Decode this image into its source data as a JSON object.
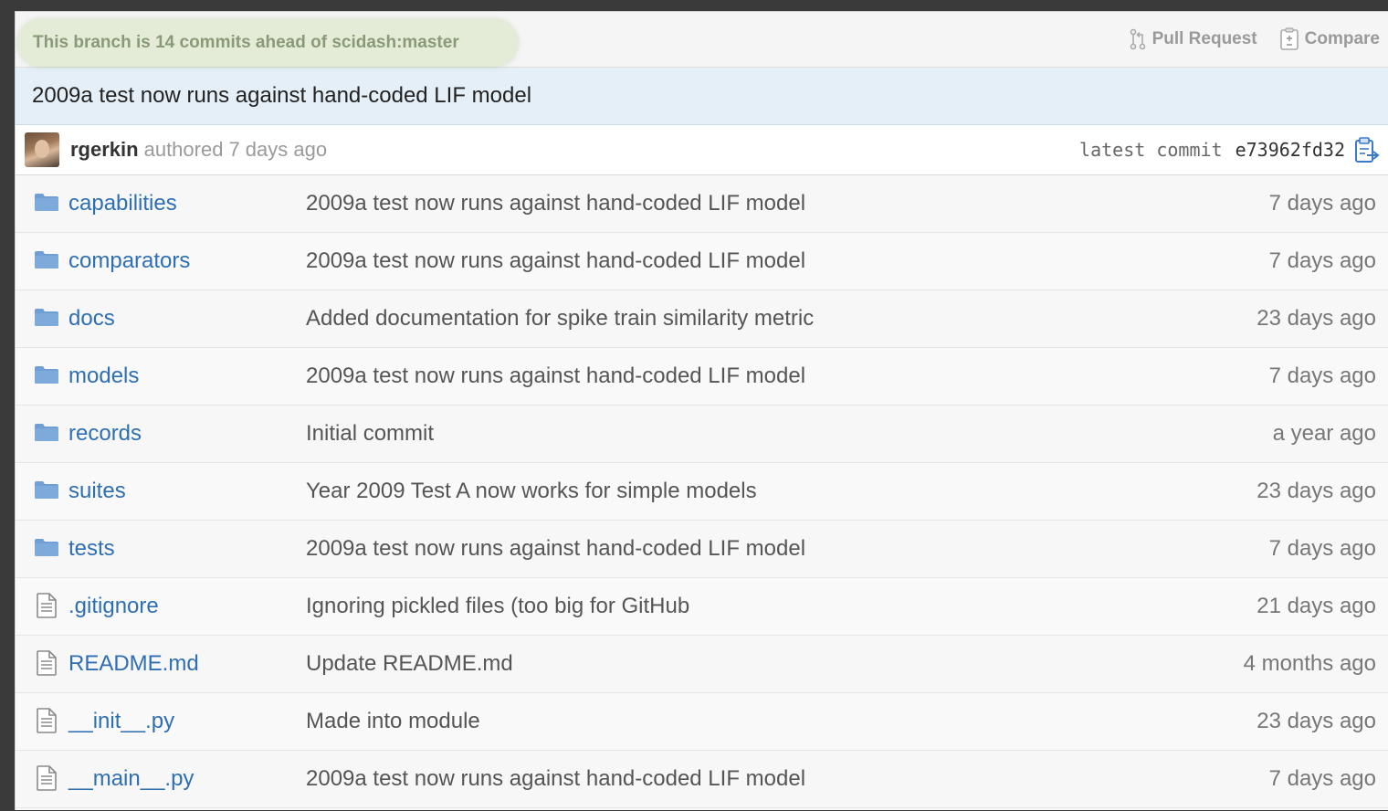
{
  "branch": {
    "status": "This branch is 14 commits ahead of scidash:master",
    "pull_request_label": "Pull Request",
    "compare_label": "Compare"
  },
  "commit": {
    "message": "2009a test now runs against hand-coded LIF model",
    "author": "rgerkin",
    "authored_label": "authored",
    "time": "7 days ago",
    "latest_label": "latest commit",
    "sha": "e73962fd32"
  },
  "files": [
    {
      "type": "folder",
      "name": "capabilities",
      "message": "2009a test now runs against hand-coded LIF model",
      "age": "7 days ago"
    },
    {
      "type": "folder",
      "name": "comparators",
      "message": "2009a test now runs against hand-coded LIF model",
      "age": "7 days ago"
    },
    {
      "type": "folder",
      "name": "docs",
      "message": "Added documentation for spike train similarity metric",
      "age": "23 days ago"
    },
    {
      "type": "folder",
      "name": "models",
      "message": "2009a test now runs against hand-coded LIF model",
      "age": "7 days ago"
    },
    {
      "type": "folder",
      "name": "records",
      "message": "Initial commit",
      "age": "a year ago"
    },
    {
      "type": "folder",
      "name": "suites",
      "message": "Year 2009 Test A now works for simple models",
      "age": "23 days ago"
    },
    {
      "type": "folder",
      "name": "tests",
      "message": "2009a test now runs against hand-coded LIF model",
      "age": "7 days ago"
    },
    {
      "type": "file",
      "name": ".gitignore",
      "message": "Ignoring pickled files (too big for GitHub",
      "age": "21 days ago"
    },
    {
      "type": "file",
      "name": "README.md",
      "message": "Update README.md",
      "age": "4 months ago"
    },
    {
      "type": "file",
      "name": "__init__.py",
      "message": "Made into module",
      "age": "23 days ago"
    },
    {
      "type": "file",
      "name": "__main__.py",
      "message": "2009a test now runs against hand-coded LIF model",
      "age": "7 days ago"
    }
  ],
  "icons": {
    "folder": "folder-icon",
    "file": "file-icon",
    "pull_request": "pull-request-icon",
    "compare": "compare-icon",
    "clipboard": "clipboard-icon"
  },
  "colors": {
    "link": "#2e6fb3",
    "folder": "#6f9fd4",
    "branch_bg": "#e4ecd7",
    "commit_bg": "#e4eff8"
  }
}
